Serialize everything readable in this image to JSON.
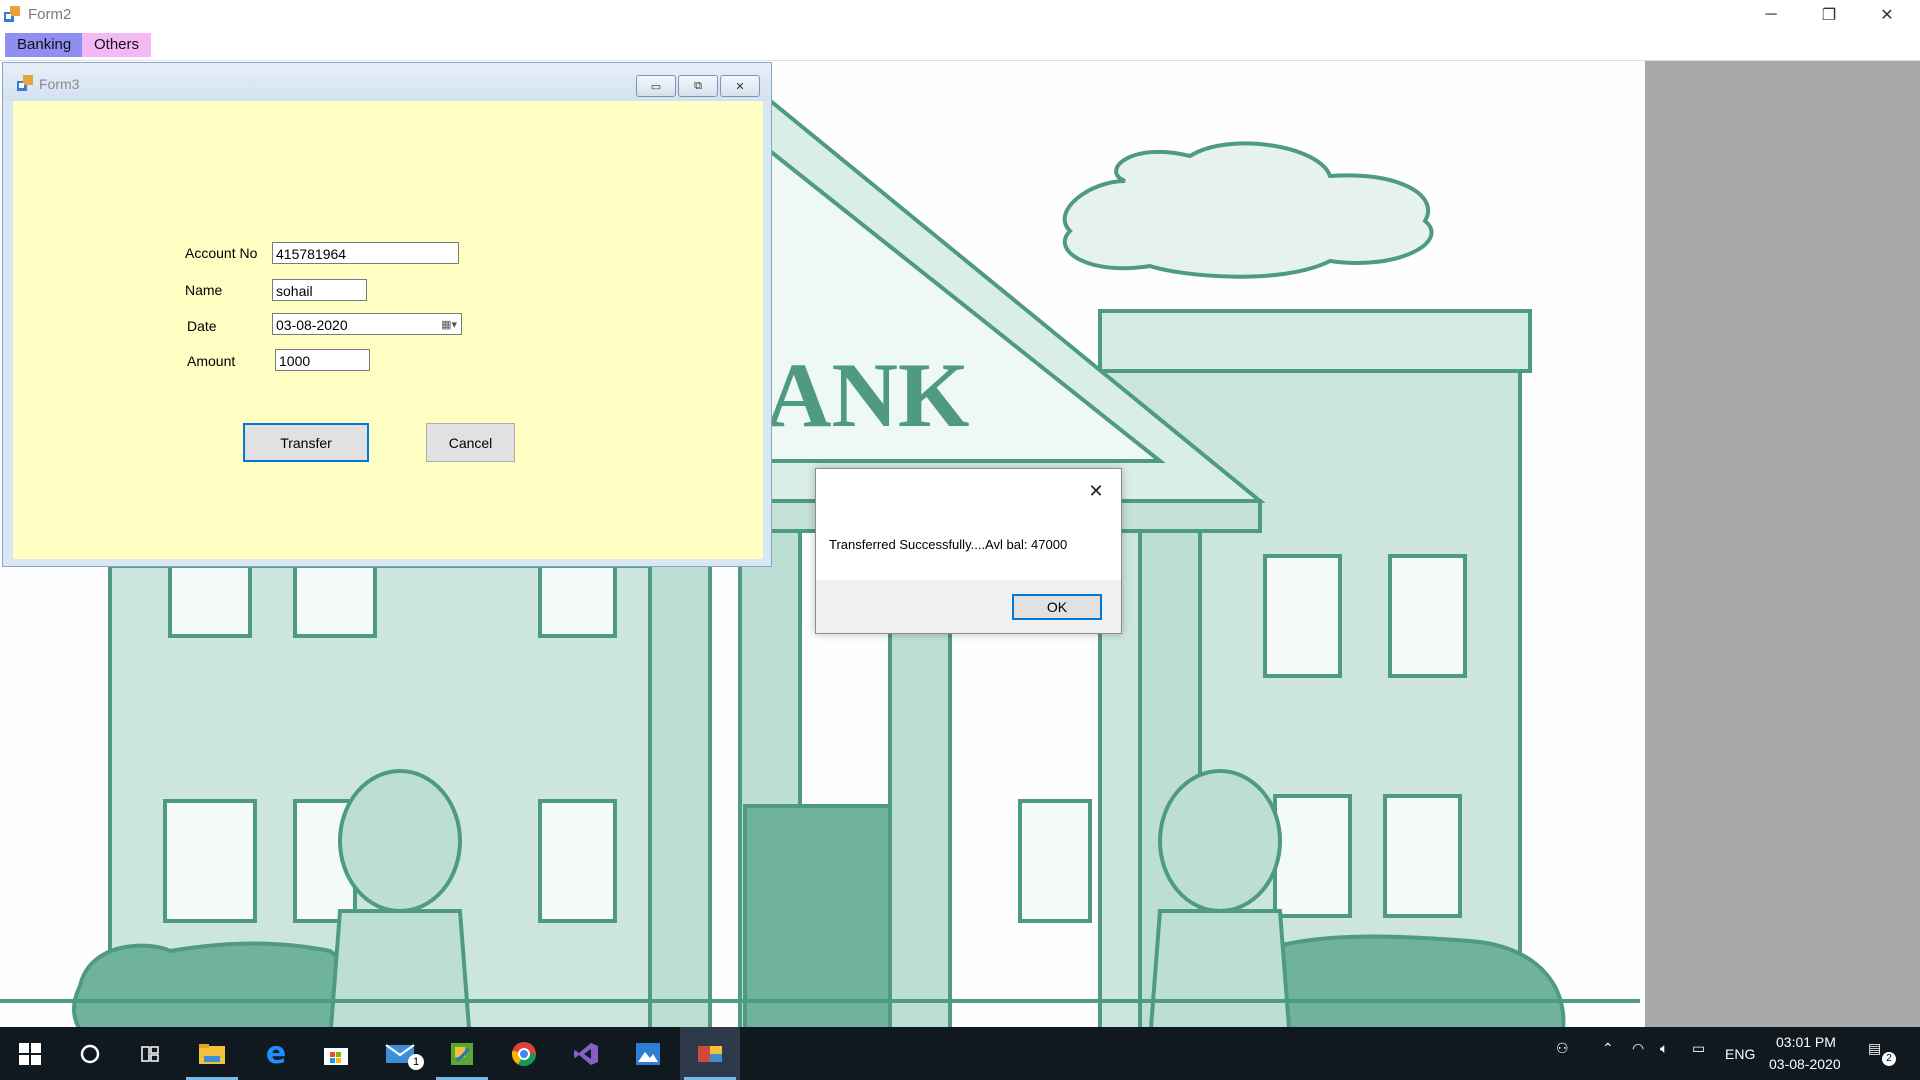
{
  "main_window": {
    "title": "Form2",
    "controls": {
      "minimize": "─",
      "restore": "❐",
      "close": "✕"
    }
  },
  "menu": {
    "items": [
      "Banking",
      "Others"
    ]
  },
  "background_image": {
    "sign_text": "ANK"
  },
  "form3": {
    "title": "Form3",
    "fields": {
      "account_no": {
        "label": "Account No",
        "value": "415781964"
      },
      "name": {
        "label": "Name",
        "value": "sohail"
      },
      "date": {
        "label": "Date",
        "value": "03-08-2020"
      },
      "amount": {
        "label": "Amount",
        "value": "1000"
      }
    },
    "buttons": {
      "transfer": "Transfer",
      "cancel": "Cancel"
    }
  },
  "message_box": {
    "text": "Transferred Successfully....Avl bal: 47000",
    "ok_label": "OK",
    "close": "✕"
  },
  "taskbar": {
    "apps": [
      "start",
      "cortana",
      "task-view",
      "file-explorer",
      "edge",
      "store",
      "mail",
      "app-flag",
      "chrome",
      "visual-studio",
      "photos",
      "winforms-app"
    ],
    "mail_badge": "1",
    "language": "ENG",
    "time": "03:01 PM",
    "date": "03-08-2020",
    "notification_count": "2"
  },
  "colors": {
    "form_background": "#ffffc3",
    "menu_banking": "#8f8ff3",
    "menu_others": "#f4b8f4",
    "accent": "#0078d7",
    "illustration": "#4e9a82"
  }
}
